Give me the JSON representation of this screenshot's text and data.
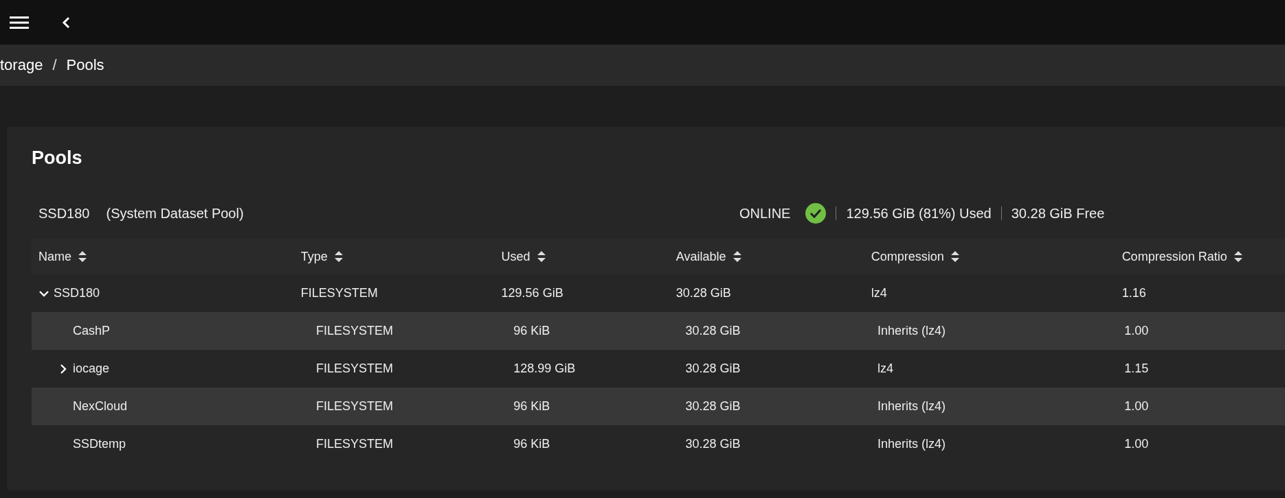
{
  "breadcrumb": [
    "torage",
    "Pools"
  ],
  "breadcrumb_separator": "/",
  "page_title": "Pools",
  "pool": {
    "name": "SSD180",
    "note": "(System Dataset Pool)",
    "status": "ONLINE",
    "healthy": true,
    "used": "129.56 GiB (81%) Used",
    "free": "30.28 GiB Free"
  },
  "table": {
    "columns": [
      "Name",
      "Type",
      "Used",
      "Available",
      "Compression",
      "Compression Ratio"
    ],
    "rows": [
      {
        "name": "SSD180",
        "type": "FILESYSTEM",
        "used": "129.56 GiB",
        "available": "30.28 GiB",
        "compression": "lz4",
        "ratio": "1.16",
        "expanded": true,
        "children": [
          {
            "name": "CashP",
            "type": "FILESYSTEM",
            "used": "96 KiB",
            "available": "30.28 GiB",
            "compression": "Inherits (lz4)",
            "ratio": "1.00"
          },
          {
            "name": "iocage",
            "type": "FILESYSTEM",
            "used": "128.99 GiB",
            "available": "30.28 GiB",
            "compression": "lz4",
            "ratio": "1.15",
            "expanded": false
          },
          {
            "name": "NexCloud",
            "type": "FILESYSTEM",
            "used": "96 KiB",
            "available": "30.28 GiB",
            "compression": "Inherits (lz4)",
            "ratio": "1.00"
          },
          {
            "name": "SSDtemp",
            "type": "FILESYSTEM",
            "used": "96 KiB",
            "available": "30.28 GiB",
            "compression": "Inherits (lz4)",
            "ratio": "1.00"
          }
        ]
      }
    ]
  }
}
